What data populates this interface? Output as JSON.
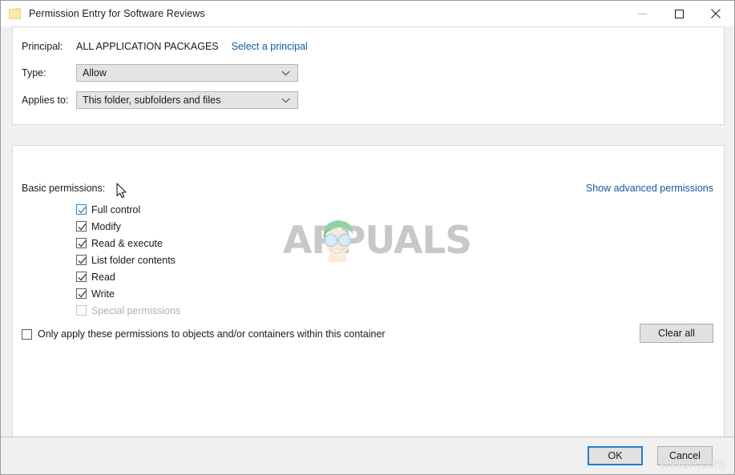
{
  "window": {
    "title": "Permission Entry for Software Reviews",
    "icon": "folder-icon",
    "minimize_label": "–",
    "maximize_label": "□",
    "close_label": "✕"
  },
  "form": {
    "principal_label": "Principal:",
    "principal_value": "ALL APPLICATION PACKAGES",
    "select_principal_link": "Select a principal",
    "type_label": "Type:",
    "type_value": "Allow",
    "applies_to_label": "Applies to:",
    "applies_to_value": "This folder, subfolders and files"
  },
  "permissions": {
    "section_label": "Basic permissions:",
    "advanced_link": "Show advanced permissions",
    "items": [
      {
        "label": "Full control",
        "checked": true,
        "disabled": false,
        "focused": true
      },
      {
        "label": "Modify",
        "checked": true,
        "disabled": false,
        "focused": false
      },
      {
        "label": "Read & execute",
        "checked": true,
        "disabled": false,
        "focused": false
      },
      {
        "label": "List folder contents",
        "checked": true,
        "disabled": false,
        "focused": false
      },
      {
        "label": "Read",
        "checked": true,
        "disabled": false,
        "focused": false
      },
      {
        "label": "Write",
        "checked": true,
        "disabled": false,
        "focused": false
      },
      {
        "label": "Special permissions",
        "checked": false,
        "disabled": true,
        "focused": false
      }
    ],
    "only_apply_label": "Only apply these permissions to objects and/or containers within this container",
    "only_apply_checked": false,
    "clear_all_label": "Clear all"
  },
  "footer": {
    "ok_label": "OK",
    "cancel_label": "Cancel"
  },
  "watermarks": {
    "center": "APPUALS",
    "center_prefix": "A",
    "center_suffix": "PUALS",
    "bottom_right": "wsxdn.com"
  },
  "colors": {
    "link": "#0f5aa0",
    "focus_border": "#1e7fd0",
    "checkbox_border": "#5c5c5c",
    "window_bg": "#f0f0f0",
    "panel_bg": "#ffffff",
    "button_bg": "#e1e1e1"
  }
}
